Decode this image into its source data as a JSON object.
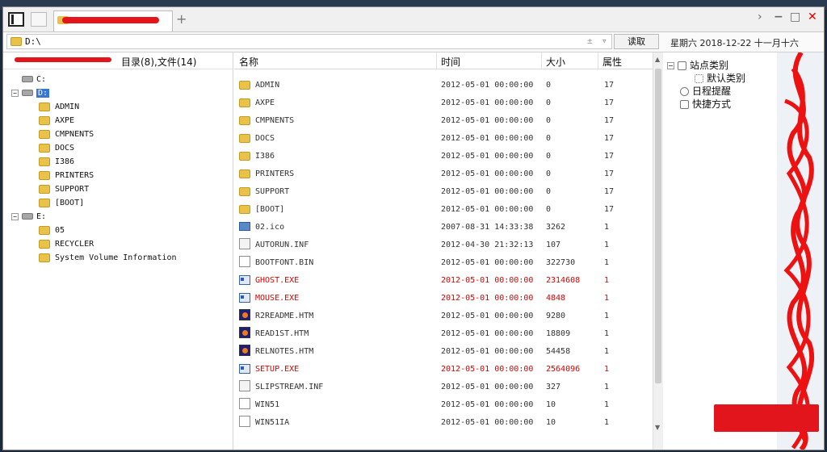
{
  "tab": {
    "title": ""
  },
  "address": {
    "path": "D:\\",
    "read_label": "读取"
  },
  "datebar": {
    "text": "星期六 2018-12-22 十一月十六"
  },
  "left_header": {
    "summary": "目录(8),文件(14)"
  },
  "tree": [
    {
      "label": "C:",
      "indent": 0,
      "type": "drive",
      "expander": ""
    },
    {
      "label": "D:",
      "indent": 0,
      "type": "drive",
      "expander": "−",
      "selected": true
    },
    {
      "label": "ADMIN",
      "indent": 1,
      "type": "folder"
    },
    {
      "label": "AXPE",
      "indent": 1,
      "type": "folder"
    },
    {
      "label": "CMPNENTS",
      "indent": 1,
      "type": "folder"
    },
    {
      "label": "DOCS",
      "indent": 1,
      "type": "folder"
    },
    {
      "label": "I386",
      "indent": 1,
      "type": "folder"
    },
    {
      "label": "PRINTERS",
      "indent": 1,
      "type": "folder"
    },
    {
      "label": "SUPPORT",
      "indent": 1,
      "type": "folder"
    },
    {
      "label": "[BOOT]",
      "indent": 1,
      "type": "folder"
    },
    {
      "label": "E:",
      "indent": 0,
      "type": "drive",
      "expander": "−"
    },
    {
      "label": "05",
      "indent": 1,
      "type": "folder"
    },
    {
      "label": "RECYCLER",
      "indent": 1,
      "type": "folder"
    },
    {
      "label": "System Volume Information",
      "indent": 1,
      "type": "folder"
    }
  ],
  "columns": {
    "name": "名称",
    "time": "时间",
    "size": "大小",
    "attr": "属性"
  },
  "files": [
    {
      "name": "ADMIN",
      "time": "2012-05-01 00:00:00",
      "size": "0",
      "attr": "17",
      "icon": "folder"
    },
    {
      "name": "AXPE",
      "time": "2012-05-01 00:00:00",
      "size": "0",
      "attr": "17",
      "icon": "folder"
    },
    {
      "name": "CMPNENTS",
      "time": "2012-05-01 00:00:00",
      "size": "0",
      "attr": "17",
      "icon": "folder"
    },
    {
      "name": "DOCS",
      "time": "2012-05-01 00:00:00",
      "size": "0",
      "attr": "17",
      "icon": "folder"
    },
    {
      "name": "I386",
      "time": "2012-05-01 00:00:00",
      "size": "0",
      "attr": "17",
      "icon": "folder"
    },
    {
      "name": "PRINTERS",
      "time": "2012-05-01 00:00:00",
      "size": "0",
      "attr": "17",
      "icon": "folder"
    },
    {
      "name": "SUPPORT",
      "time": "2012-05-01 00:00:00",
      "size": "0",
      "attr": "17",
      "icon": "folder"
    },
    {
      "name": "[BOOT]",
      "time": "2012-05-01 00:00:00",
      "size": "0",
      "attr": "17",
      "icon": "folder"
    },
    {
      "name": "02.ico",
      "time": "2007-08-31 14:33:38",
      "size": "3262",
      "attr": "1",
      "icon": "icoimg"
    },
    {
      "name": "AUTORUN.INF",
      "time": "2012-04-30 21:32:13",
      "size": "107",
      "attr": "1",
      "icon": "ini"
    },
    {
      "name": "BOOTFONT.BIN",
      "time": "2012-05-01 00:00:00",
      "size": "322730",
      "attr": "1",
      "icon": "file"
    },
    {
      "name": "GHOST.EXE",
      "time": "2012-05-01 00:00:00",
      "size": "2314608",
      "attr": "1",
      "icon": "exe",
      "red": true
    },
    {
      "name": "MOUSE.EXE",
      "time": "2012-05-01 00:00:00",
      "size": "4848",
      "attr": "1",
      "icon": "exe",
      "red": true
    },
    {
      "name": "R2README.HTM",
      "time": "2012-05-01 00:00:00",
      "size": "9280",
      "attr": "1",
      "icon": "htm"
    },
    {
      "name": "READ1ST.HTM",
      "time": "2012-05-01 00:00:00",
      "size": "18809",
      "attr": "1",
      "icon": "htm"
    },
    {
      "name": "RELNOTES.HTM",
      "time": "2012-05-01 00:00:00",
      "size": "54458",
      "attr": "1",
      "icon": "htm"
    },
    {
      "name": "SETUP.EXE",
      "time": "2012-05-01 00:00:00",
      "size": "2564096",
      "attr": "1",
      "icon": "exe",
      "red": true
    },
    {
      "name": "SLIPSTREAM.INF",
      "time": "2012-05-01 00:00:00",
      "size": "327",
      "attr": "1",
      "icon": "ini"
    },
    {
      "name": "WIN51",
      "time": "2012-05-01 00:00:00",
      "size": "10",
      "attr": "1",
      "icon": "file"
    },
    {
      "name": "WIN51IA",
      "time": "2012-05-01 00:00:00",
      "size": "10",
      "attr": "1",
      "icon": "file"
    }
  ],
  "sidebar": {
    "items": [
      {
        "label": "站点类别",
        "expander": "−"
      },
      {
        "label": "默认类别"
      },
      {
        "label": "日程提醒"
      },
      {
        "label": "快捷方式"
      }
    ]
  },
  "colors": {
    "accent": "#3875d7",
    "highlight_red": "#dd0000",
    "scribble": "#ee1111"
  }
}
